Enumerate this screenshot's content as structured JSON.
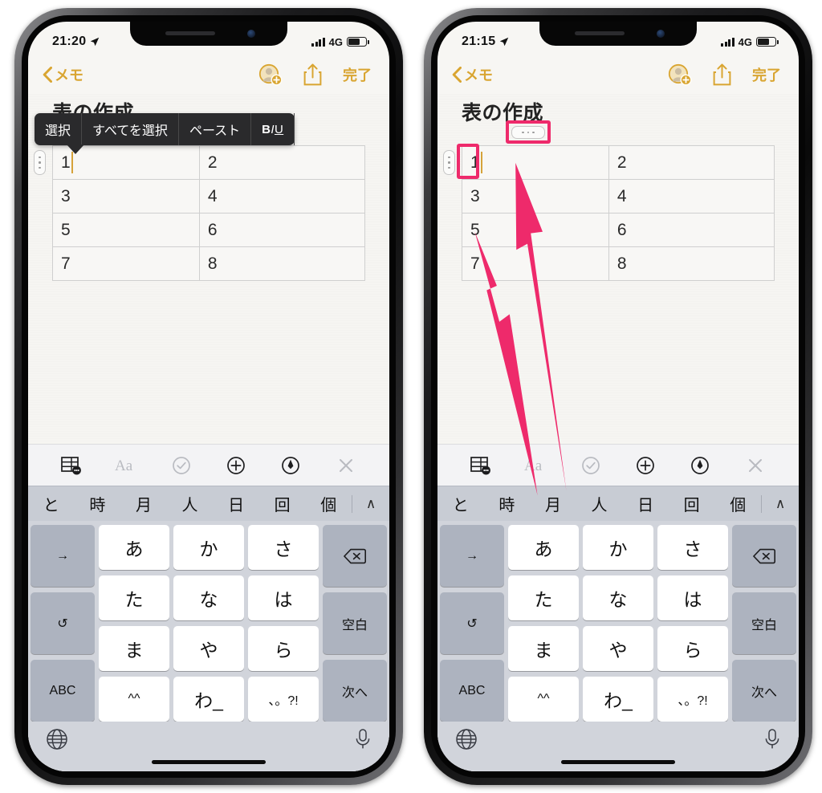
{
  "meta": {
    "accent_gold": "#d9a531",
    "annotation_pink": "#ee2a6b",
    "caret_color": "#d6a23a"
  },
  "phones": [
    {
      "id": "left",
      "status": {
        "time": "21:20",
        "network": "4G",
        "location_icon": "location-arrow-icon",
        "signal_icon": "signal-bars-icon",
        "battery_icon": "battery-icon"
      },
      "nav": {
        "back_label": "メモ",
        "back_icon": "chevron-left-icon",
        "collaborate_icon": "add-person-icon",
        "share_icon": "share-icon",
        "done_label": "完了"
      },
      "note": {
        "title": "表の作成"
      },
      "context_menu": {
        "visible": true,
        "items": [
          "選択",
          "すべてを選択",
          "ペースト"
        ],
        "format_b": "B",
        "format_i": "I",
        "format_u": "U"
      },
      "annotations": {
        "visible": false
      }
    },
    {
      "id": "right",
      "status": {
        "time": "21:15",
        "network": "4G",
        "location_icon": "location-arrow-icon",
        "signal_icon": "signal-bars-icon",
        "battery_icon": "battery-icon"
      },
      "nav": {
        "back_label": "メモ",
        "back_icon": "chevron-left-icon",
        "collaborate_icon": "add-person-icon",
        "share_icon": "share-icon",
        "done_label": "完了"
      },
      "note": {
        "title": "表の作成"
      },
      "context_menu": {
        "visible": false
      },
      "annotations": {
        "visible": true,
        "highlight_row_handle": true,
        "highlight_column_handle": true,
        "arrow_count": 2
      }
    }
  ],
  "table": {
    "rows": [
      [
        "1",
        "2"
      ],
      [
        "3",
        "4"
      ],
      [
        "5",
        "6"
      ],
      [
        "7",
        "8"
      ]
    ],
    "caret_cell": {
      "row": 0,
      "col": 0
    },
    "row_handle_icon": "row-grip-icon",
    "column_handle_icon": "column-grip-icon"
  },
  "keyboard": {
    "toolbar": [
      {
        "name": "table-icon",
        "state": "active"
      },
      {
        "name": "text-format-icon",
        "state": "disabled"
      },
      {
        "name": "checklist-icon",
        "state": "disabled"
      },
      {
        "name": "add-attachment-icon",
        "state": "active"
      },
      {
        "name": "markup-pen-icon",
        "state": "active"
      },
      {
        "name": "close-keyboard-icon",
        "state": "disabled"
      }
    ],
    "predictions": [
      "と",
      "時",
      "月",
      "人",
      "日",
      "回",
      "個"
    ],
    "collapse_label": "∧",
    "rows": [
      {
        "left": "→",
        "center": [
          "あ",
          "か",
          "さ"
        ],
        "right": "delete-icon"
      },
      {
        "left": "↺",
        "center": [
          "た",
          "な",
          "は"
        ],
        "right": "空白"
      },
      {
        "left": "ABC",
        "center": [
          "ま",
          "や",
          "ら"
        ],
        "right": "次へ"
      },
      {
        "left": "",
        "center": [
          "^^",
          "わ_",
          "、。?!"
        ],
        "right": ""
      }
    ],
    "bottom": {
      "globe_icon": "globe-icon",
      "mic_icon": "microphone-icon"
    }
  }
}
